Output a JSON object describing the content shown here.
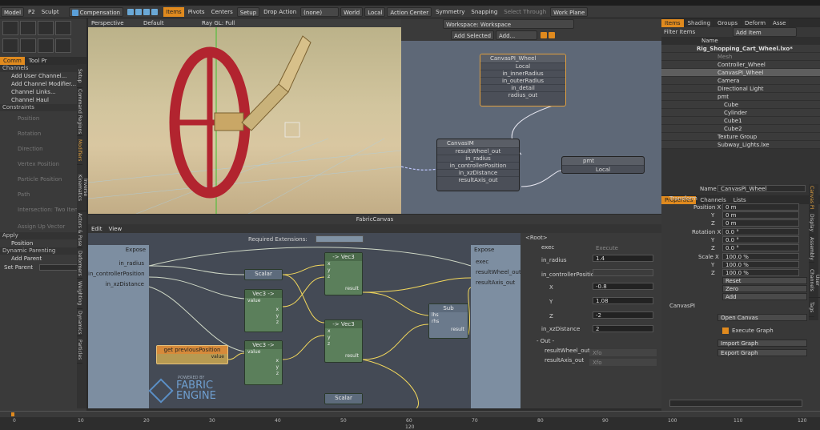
{
  "toolbar": {
    "model": "Model",
    "p2": "P2",
    "sculpt": "Sculpt",
    "compensation": "Compensation",
    "items": "Items",
    "pivots": "Pivots",
    "centers": "Centers",
    "setup": "Setup",
    "drop_action": "Drop Action",
    "none": "(none)",
    "world": "World",
    "local": "Local",
    "action_center": "Action Center",
    "symmetry": "Symmetry",
    "snapping": "Snapping",
    "select_through": "Select Through",
    "work_plane": "Work Plane"
  },
  "left": {
    "tabs": [
      "Comm",
      "Tool Pr"
    ],
    "channels_header": "Channels",
    "channels": [
      "Add User Channel...",
      "Add Channel Modifier...",
      "Channel Links...",
      "Channel Haul"
    ],
    "constraints_header": "Constraints",
    "constraints": [
      "Position",
      "Rotation",
      "Direction",
      "Vertex Position",
      "Particle Position",
      "Path",
      "Intersection: Two Items"
    ],
    "assign_up": "Assign Up Vector",
    "apply_header": "Apply",
    "apply_position": "Position",
    "dynparent_header": "Dynamic Parenting",
    "add_parent": "Add Parent",
    "set_parent": "Set Parent",
    "vtabs": [
      "Setup",
      "Command Regions",
      "Modifiers",
      "Inverse Kinematics",
      "Actors & Pose",
      "Deformers",
      "Weighting",
      "Dynamics",
      "Particles"
    ]
  },
  "viewport": {
    "view": "Perspective",
    "shading": "Default",
    "render": "Ray GL: Full"
  },
  "schematic": {
    "workspace": "Workspace: Workspace",
    "add_selected": "Add Selected",
    "add": "Add...",
    "node1": {
      "title": "CanvasPI_Wheel",
      "ports": [
        "Local",
        "in_innerRadius",
        "in_outerRadius",
        "in_detail",
        "radius_out"
      ]
    },
    "node2": {
      "title": "CanvasIM",
      "ports": [
        "resultWheel_out",
        "in_radius",
        "in_controllerPosition",
        "in_xzDistance",
        "resultAxis_out"
      ]
    },
    "node3": {
      "title": "pmt",
      "ports": [
        "Local"
      ]
    }
  },
  "fabric": {
    "title": "FabricCanvas",
    "menu": [
      "Edit",
      "View"
    ],
    "required_ext": "Required Extensions:",
    "expose": "Expose",
    "inputs": [
      "in_radius",
      "in_controllerPosition",
      "in_xzDistance"
    ],
    "outputs": [
      "exec",
      "resultWheel_out",
      "resultAxis_out"
    ],
    "nodes": {
      "scalar": "Scalar",
      "vec3a": "-> Vec3",
      "vec3b": "-> Vec3",
      "vec3c": "Vec3 ->",
      "vec3d": "Vec3 ->",
      "sub": "Sub",
      "scalar2": "Scalar",
      "getprev": "get previousPosition"
    },
    "ports": {
      "value": "value",
      "x": "x",
      "y": "y",
      "z": "z",
      "result": "result",
      "lhs": "lhs",
      "rhs": "rhs"
    },
    "logo": [
      "FABRIC",
      "ENGINE"
    ],
    "powered": "POWERED BY",
    "side": {
      "root": "<Root>",
      "exec": "exec",
      "exec_val": "Execute",
      "in_radius": "in_radius",
      "in_radius_val": "1.4",
      "in_cp": "in_controllerPosition",
      "x": "X",
      "y": "Y",
      "z": "Z",
      "x_val": "-0.8",
      "y_val": "1.08",
      "z_val": "-2",
      "in_xz": "in_xzDistance",
      "in_xz_val": "2",
      "out": "- Out -",
      "rw": "resultWheel_out",
      "ra": "resultAxis_out",
      "rw_val": "Xfo",
      "ra_val": "Xfo"
    }
  },
  "right": {
    "tabs": [
      "Items",
      "Shading",
      "Groups",
      "Deform",
      "Asse"
    ],
    "filter": "Filter Items",
    "add_item": "Add Item",
    "name_col": "Name",
    "tree": [
      "Rig_Shopping_Cart_Wheel.lxo*",
      "Mesh",
      "Controller_Wheel",
      "CanvasPI_Wheel",
      "Camera",
      "Directional Light",
      "pmt",
      "Cube",
      "Cylinder",
      "Cube1",
      "Cube2",
      "Texture Group",
      "Subway_Lights.lxe"
    ],
    "ptabs": [
      "Properties",
      "Channels",
      "Lists"
    ],
    "name_label": "Name",
    "name_val": "CanvasPI_Wheel",
    "transform": "Transform",
    "pos": "Position X",
    "rot": "Rotation X",
    "scl": "Scale X",
    "y": "Y",
    "z": "Z",
    "pos_vals": [
      "0 m",
      "0 m",
      "0 m"
    ],
    "rot_vals": [
      "0.0 °",
      "0.0 °",
      "0.0 °"
    ],
    "scl_vals": [
      "100.0 %",
      "100.0 %",
      "100.0 %"
    ],
    "reset": "Reset",
    "zero": "Zero",
    "addbtn": "Add",
    "canvaspi": "CanvasPI",
    "open_canvas": "Open Canvas",
    "execute_graph": "Execute Graph",
    "import_graph": "Import Graph",
    "export_graph": "Export Graph",
    "side_tabs": [
      "Canvas PI",
      "Display",
      "Assembly",
      "User Channels",
      "Tags"
    ]
  },
  "timeline": {
    "ticks": [
      "0",
      "10",
      "20",
      "30",
      "40",
      "50",
      "60",
      "70",
      "80",
      "90",
      "100",
      "110",
      "120"
    ],
    "end": "120"
  }
}
